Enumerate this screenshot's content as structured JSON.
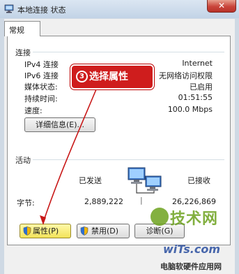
{
  "window": {
    "title": "本地连接 状态",
    "close_label": "✕"
  },
  "tabs": [
    {
      "label": "常规"
    }
  ],
  "connection": {
    "group_label": "连接",
    "rows": [
      {
        "label": "IPv4 连接",
        "value": "Internet"
      },
      {
        "label": "IPv6 连接",
        "value": "无网络访问权限"
      },
      {
        "label": "媒体状态:",
        "value": "已启用"
      },
      {
        "label": "持续时间:",
        "value": "01:51:55"
      },
      {
        "label": "速度:",
        "value": "100.0 Mbps"
      }
    ],
    "details_button": "详细信息(E)..."
  },
  "activity": {
    "group_label": "活动",
    "sent_label": "已发送",
    "received_label": "已接收",
    "bytes_label": "字节:",
    "bytes_sent": "2,889,222",
    "bytes_received": "26,226,869",
    "separator": "|"
  },
  "buttons": {
    "properties": "属性(P)",
    "disable": "禁用(D)",
    "diagnose": "诊断(G)"
  },
  "annotation": {
    "number": "3",
    "text": "选择属性"
  },
  "watermark": {
    "main": "技术网",
    "site": "wiTs.com",
    "subtitle": "电脑软硬件应用网"
  },
  "icons": {
    "title": "network-icon",
    "network_activity": "computers-network-icon",
    "shield": "uac-shield-icon"
  },
  "colors": {
    "annotation": "#cf1d1d",
    "watermark_green": "#6da21e",
    "watermark_blue": "#2a4ea0"
  }
}
